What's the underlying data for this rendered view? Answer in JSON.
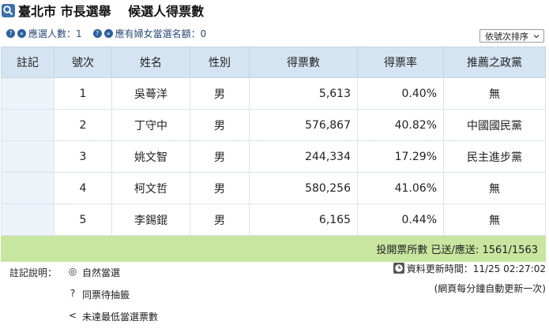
{
  "title": "臺北市 市長選舉　 候選人得票數",
  "stats": {
    "elected_label": "應選人數：1",
    "female_quota_label": "應有婦女當選名額：0"
  },
  "sort": {
    "selected": "依號次排序"
  },
  "table": {
    "headers": [
      "註記",
      "號次",
      "姓名",
      "性別",
      "得票數",
      "得票率",
      "推薦之政黨"
    ],
    "rows": [
      {
        "note": "",
        "number": "1",
        "name": "吳蕚洋",
        "gender": "男",
        "votes": "5,613",
        "rate": "0.40%",
        "party": "無"
      },
      {
        "note": "",
        "number": "2",
        "name": "丁守中",
        "gender": "男",
        "votes": "576,867",
        "rate": "40.82%",
        "party": "中國國民黨"
      },
      {
        "note": "",
        "number": "3",
        "name": "姚文智",
        "gender": "男",
        "votes": "244,334",
        "rate": "17.29%",
        "party": "民主進步黨"
      },
      {
        "note": "",
        "number": "4",
        "name": "柯文哲",
        "gender": "男",
        "votes": "580,256",
        "rate": "41.06%",
        "party": "無"
      },
      {
        "note": "",
        "number": "5",
        "name": "李錫錕",
        "gender": "男",
        "votes": "6,165",
        "rate": "0.44%",
        "party": "無"
      }
    ],
    "footer": "投開票所數 已送/應送: 1561/1563"
  },
  "legend": {
    "label": "註記說明：",
    "items": [
      {
        "symbol": "◎",
        "text": "自然當選"
      },
      {
        "symbol": "?",
        "text": "同票待抽籤"
      },
      {
        "symbol": "<",
        "text": "未達最低當選票數"
      }
    ]
  },
  "update": {
    "time_text": "資料更新時間：11/25 02:27:02",
    "refresh_note": "(網頁每分鐘自動更新一次)"
  },
  "colors": {
    "header_bg": "#d5e4f2",
    "footer_bg": "#c8e6a0",
    "accent": "#2b5f9e"
  }
}
